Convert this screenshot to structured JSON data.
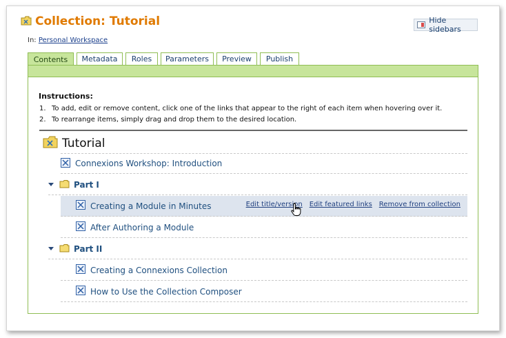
{
  "header": {
    "title": "Collection: Tutorial",
    "hide_sidebars": "Hide sidebars",
    "in_label": "In:",
    "workspace_link": "Personal Workspace"
  },
  "tabs": [
    {
      "label": "Contents",
      "active": true
    },
    {
      "label": "Metadata",
      "active": false
    },
    {
      "label": "Roles",
      "active": false
    },
    {
      "label": "Parameters",
      "active": false
    },
    {
      "label": "Preview",
      "active": false
    },
    {
      "label": "Publish",
      "active": false
    }
  ],
  "instructions": {
    "heading": "Instructions:",
    "items": [
      {
        "num": "1.",
        "text": "To add, edit or remove content, click one of the links that appear to the right of each item when hovering over it."
      },
      {
        "num": "2.",
        "text": "To rearrange items, simply drag and drop them to the desired location."
      }
    ]
  },
  "tree": {
    "root": "Tutorial",
    "intro_module": "Connexions Workshop: Introduction",
    "parts": [
      {
        "title": "Part I",
        "modules": [
          "Creating a Module in Minutes",
          "After Authoring a Module"
        ]
      },
      {
        "title": "Part II",
        "modules": [
          "Creating a Connexions Collection",
          "How to Use the Collection Composer"
        ]
      }
    ],
    "hover_actions": [
      "Edit title/version",
      "Edit featured links",
      "Remove from collection"
    ]
  },
  "colors": {
    "title": "#e07a00",
    "tab_active": "#c7e59b",
    "hover_row": "#dde4ee",
    "link": "#1f4f7f"
  },
  "icons": {
    "folder": "folder-icon",
    "module": "module-doc-icon",
    "hide_sidebars": "sidebar-toggle-icon",
    "cursor": "hand-pointer-icon"
  }
}
